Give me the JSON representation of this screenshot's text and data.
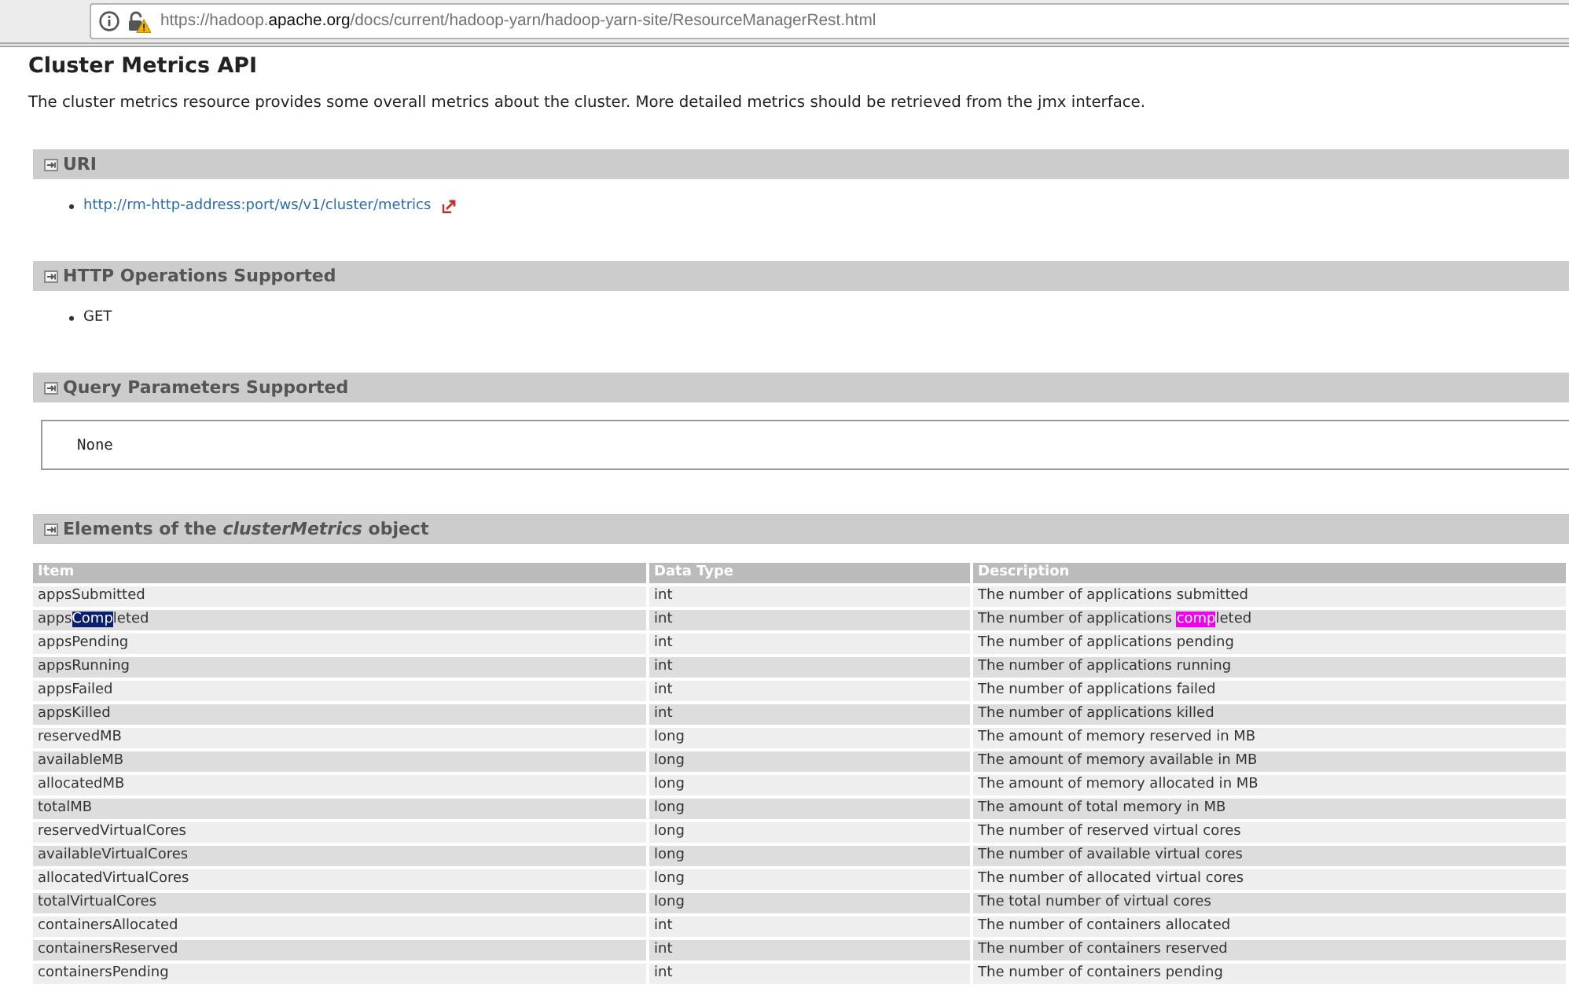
{
  "browser": {
    "url": {
      "host_prefix": "https://hadoop.",
      "domain": "apache.org",
      "path": "/docs/current/hadoop-yarn/hadoop-yarn-site/ResourceManagerRest.html"
    }
  },
  "page": {
    "title": "Cluster Metrics API",
    "intro": "The cluster metrics resource provides some overall metrics about the cluster. More detailed metrics should be retrieved from the jmx interface."
  },
  "sections": [
    {
      "title": "URI",
      "kind": "list",
      "items": [
        {
          "text": "http://rm-http-address:port/ws/v1/cluster/metrics",
          "link": true
        }
      ]
    },
    {
      "title": "HTTP Operations Supported",
      "kind": "list",
      "items": [
        {
          "text": "GET",
          "link": false
        }
      ]
    },
    {
      "title": "Query Parameters Supported",
      "kind": "code",
      "code": "None"
    },
    {
      "title": "Elements of the *clusterMetrics* object",
      "kind": "table",
      "columns": [
        "Item",
        "Data Type",
        "Description"
      ],
      "rows": [
        {
          "item": "appsSubmitted",
          "data_type": "int",
          "description": "The number of applications submitted"
        },
        {
          "item": [
            {
              "text": "apps",
              "kind": "plain"
            },
            {
              "text": "Comp",
              "kind": "selection"
            },
            {
              "text": "leted",
              "kind": "plain"
            }
          ],
          "data_type": "int",
          "description": [
            {
              "text": "The number of applications ",
              "kind": "plain"
            },
            {
              "text": "comp",
              "kind": "match"
            },
            {
              "text": "leted",
              "kind": "plain"
            }
          ]
        },
        {
          "item": "appsPending",
          "data_type": "int",
          "description": "The number of applications pending"
        },
        {
          "item": "appsRunning",
          "data_type": "int",
          "description": "The number of applications running"
        },
        {
          "item": "appsFailed",
          "data_type": "int",
          "description": "The number of applications failed"
        },
        {
          "item": "appsKilled",
          "data_type": "int",
          "description": "The number of applications killed"
        },
        {
          "item": "reservedMB",
          "data_type": "long",
          "description": "The amount of memory reserved in MB"
        },
        {
          "item": "availableMB",
          "data_type": "long",
          "description": "The amount of memory available in MB"
        },
        {
          "item": "allocatedMB",
          "data_type": "long",
          "description": "The amount of memory allocated in MB"
        },
        {
          "item": "totalMB",
          "data_type": "long",
          "description": "The amount of total memory in MB"
        },
        {
          "item": "reservedVirtualCores",
          "data_type": "long",
          "description": "The number of reserved virtual cores"
        },
        {
          "item": "availableVirtualCores",
          "data_type": "long",
          "description": "The number of available virtual cores"
        },
        {
          "item": "allocatedVirtualCores",
          "data_type": "long",
          "description": "The number of allocated virtual cores"
        },
        {
          "item": "totalVirtualCores",
          "data_type": "long",
          "description": "The total number of virtual cores"
        },
        {
          "item": "containersAllocated",
          "data_type": "int",
          "description": "The number of containers allocated"
        },
        {
          "item": "containersReserved",
          "data_type": "int",
          "description": "The number of containers reserved"
        },
        {
          "item": "containersPending",
          "data_type": "int",
          "description": "The number of containers pending"
        }
      ]
    }
  ]
}
